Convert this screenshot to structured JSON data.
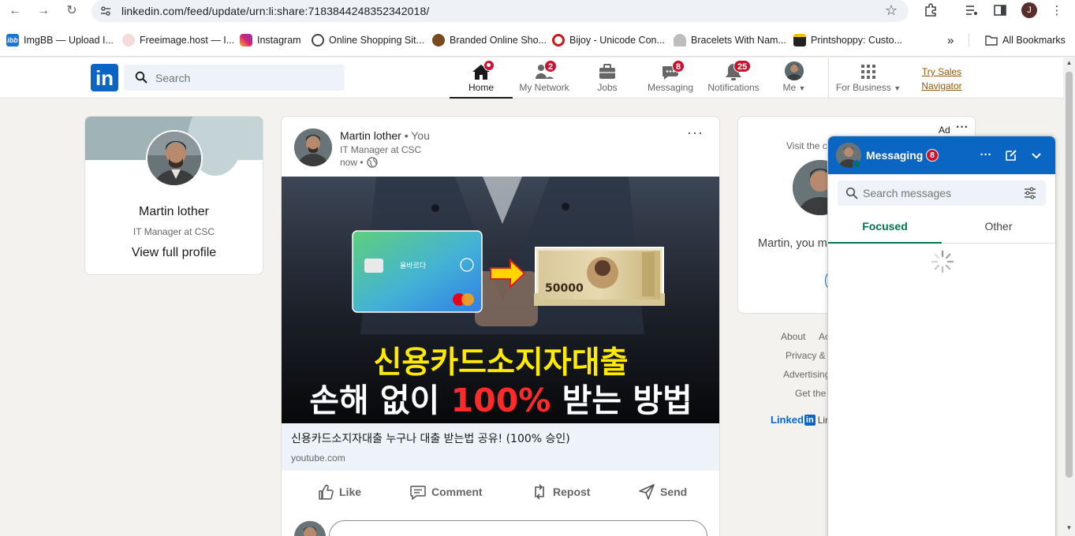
{
  "browser": {
    "url": "linkedin.com/feed/update/urn:li:share:7183844248352342018/",
    "profile_initial": "J",
    "bookmarks": [
      {
        "label": "ImgBB — Upload I...",
        "icon": "ibb",
        "color": "#1b74d9"
      },
      {
        "label": "Freeimage.host — I...",
        "icon": "",
        "color": "#f0d2d2"
      },
      {
        "label": "Instagram",
        "icon": "",
        "color": "#d6246e"
      },
      {
        "label": "Online Shopping Sit...",
        "icon": "",
        "color": "#444444"
      },
      {
        "label": "Branded Online Sho...",
        "icon": "",
        "color": "#7a4a1e"
      },
      {
        "label": "Bijoy - Unicode Con...",
        "icon": "",
        "color": "#c7181f"
      },
      {
        "label": "Bracelets With Nam...",
        "icon": "",
        "color": "#888888"
      },
      {
        "label": "Printshoppy: Custo...",
        "icon": "",
        "color": "#222222"
      }
    ],
    "all_bookmarks_label": "All Bookmarks"
  },
  "header": {
    "search_placeholder": "Search",
    "nav": [
      {
        "label": "Home",
        "badge": "",
        "dot": true,
        "active": true
      },
      {
        "label": "My Network",
        "badge": "2"
      },
      {
        "label": "Jobs",
        "badge": ""
      },
      {
        "label": "Messaging",
        "badge": "8"
      },
      {
        "label": "Notifications",
        "badge": "25"
      },
      {
        "label": "Me",
        "badge": ""
      },
      {
        "label": "For Business",
        "badge": ""
      }
    ],
    "try_sales_line1": "Try Sales",
    "try_sales_line2": "Navigator"
  },
  "profile": {
    "name": "Martin lother",
    "title": "IT Manager at CSC",
    "view_link": "View full profile"
  },
  "post": {
    "author": "Martin lother",
    "author_suffix": "• You",
    "headline": "IT Manager at CSC",
    "time": "now •",
    "image_text_line1": "신용카드소지자대출",
    "image_text_line2a": "손해 없이 ",
    "image_text_line2b": "100%",
    "image_text_line2c": " 받는 방법",
    "card_text": "올바르다",
    "banknote_value": "50000",
    "link_title": "신용카드소지자대출 누구나 대출 받는법 공유! (100% 승인)",
    "link_domain": "youtube.com",
    "actions": {
      "like": "Like",
      "comment": "Comment",
      "repost": "Repost",
      "send": "Send"
    }
  },
  "ad": {
    "label": "Ad",
    "visit_text": "Visit the c",
    "greeting": "Martin, you m"
  },
  "footer": {
    "links": [
      "About",
      "Ac",
      "Privacy & T",
      "Advertising",
      "Get the"
    ],
    "brand": "Linked",
    "brand_in": "in",
    "brand_tail": "Lin"
  },
  "messaging": {
    "title": "Messaging",
    "badge": "8",
    "search_placeholder": "Search messages",
    "tabs": [
      "Focused",
      "Other"
    ]
  },
  "colors": {
    "linkedin_blue": "#0a66c2",
    "badge_red": "#cb112d",
    "focus_green": "#01754f",
    "try_sales": "#915907"
  }
}
